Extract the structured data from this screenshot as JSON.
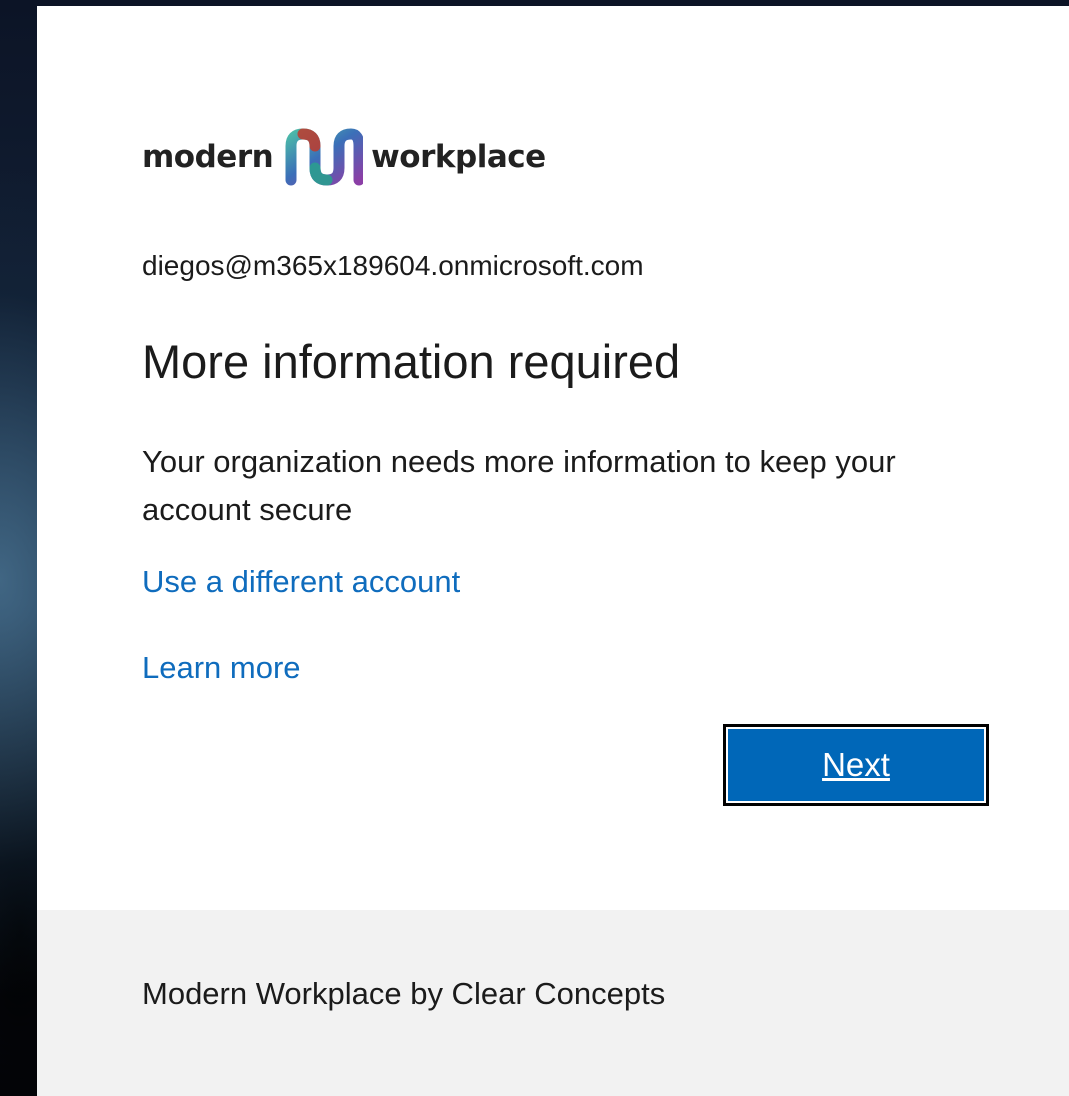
{
  "logo": {
    "left_text": "modern",
    "right_text": "workplace",
    "icon": "modern-workplace-m-logo-icon"
  },
  "account": {
    "email": "diegos@m365x189604.onmicrosoft.com"
  },
  "main": {
    "title": "More information required",
    "description": "Your organization needs more information to keep your account secure",
    "use_different_account_link": "Use a different account",
    "learn_more_link": "Learn more",
    "next_button": "Next"
  },
  "footer": {
    "text": "Modern Workplace by Clear Concepts"
  },
  "colors": {
    "link": "#0f6cbd",
    "primary_button": "#0067b8",
    "footer_background": "#f2f2f2",
    "card_background": "#ffffff"
  }
}
